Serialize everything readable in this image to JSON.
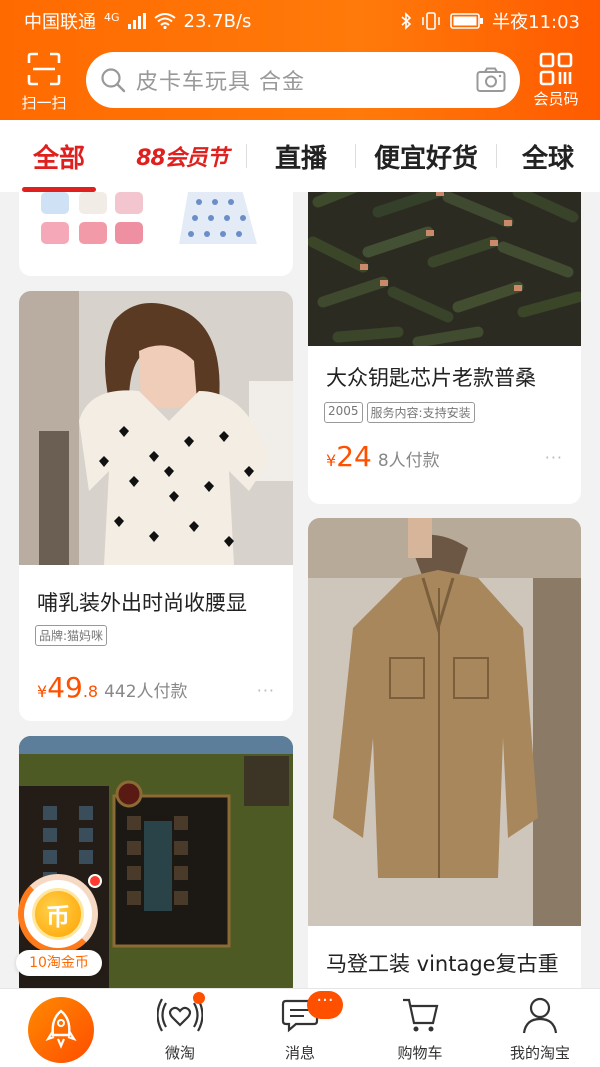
{
  "status_bar": {
    "carrier": "中国联通",
    "network": "4G",
    "speed": "23.7B/s",
    "time": "半夜11:03"
  },
  "header": {
    "scan_label": "扫一扫",
    "search_placeholder": "皮卡车玩具 合金",
    "member_label": "会员码"
  },
  "tabs": [
    {
      "label": "全部",
      "active": true
    },
    {
      "label": "88会员节",
      "active": false
    },
    {
      "label": "直播",
      "active": false
    },
    {
      "label": "便宜好货",
      "active": false
    },
    {
      "label": "全球",
      "active": false
    }
  ],
  "products": [
    {
      "title": "大众钥匙芯片老款普桑",
      "tags": [
        "2005",
        "服务内容:支持安装"
      ],
      "price_symbol": "¥",
      "price_int": "24",
      "price_dec": "",
      "sold": "8人付款"
    },
    {
      "title": "哺乳装外出时尚收腰显",
      "tags": [
        "品牌:猫妈咪"
      ],
      "price_symbol": "¥",
      "price_int": "49",
      "price_dec": ".8",
      "sold": "442人付款"
    },
    {
      "title": "马登工装 vintage复古重",
      "tags": [],
      "price_symbol": "",
      "price_int": "",
      "price_dec": "",
      "sold": ""
    }
  ],
  "more_label": "···",
  "coin": {
    "glyph": "币",
    "label": "10淘金币"
  },
  "bottom_nav": [
    {
      "label": "",
      "icon": "home-rocket-icon"
    },
    {
      "label": "微淘",
      "icon": "heart-signal-icon"
    },
    {
      "label": "消息",
      "icon": "chat-bubble-icon"
    },
    {
      "label": "购物车",
      "icon": "cart-icon"
    },
    {
      "label": "我的淘宝",
      "icon": "user-icon"
    }
  ],
  "badges": {
    "messages": "···"
  },
  "colors": {
    "brand_orange": "#ff6a00",
    "active_red": "#e0201e",
    "price": "#ff5000"
  }
}
